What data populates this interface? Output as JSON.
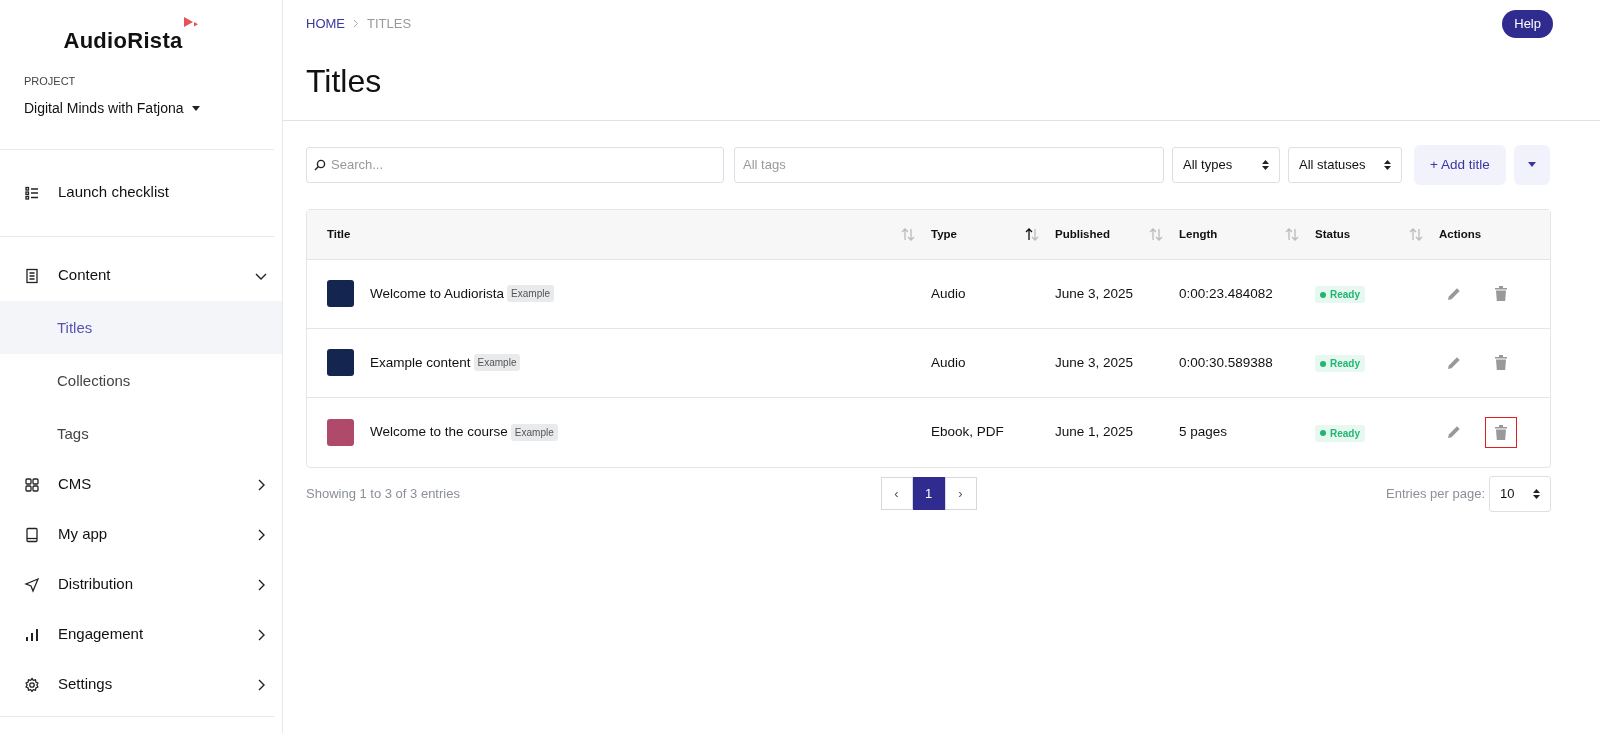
{
  "sidebar": {
    "logo": "AudioRista",
    "project_label": "PROJECT",
    "project_name": "Digital Minds with Fatjona",
    "sections": [
      [
        {
          "label": "Launch checklist",
          "kind": "item"
        }
      ],
      [
        {
          "label": "Content",
          "kind": "group",
          "expanded": true,
          "children": [
            {
              "label": "Titles",
              "selected": true
            },
            {
              "label": "Collections",
              "selected": false
            },
            {
              "label": "Tags",
              "selected": false
            }
          ]
        },
        {
          "label": "CMS",
          "kind": "group",
          "expanded": false
        },
        {
          "label": "My app",
          "kind": "group",
          "expanded": false
        },
        {
          "label": "Distribution",
          "kind": "group",
          "expanded": false
        },
        {
          "label": "Engagement",
          "kind": "group",
          "expanded": false
        },
        {
          "label": "Settings",
          "kind": "group",
          "expanded": false
        }
      ]
    ]
  },
  "breadcrumb": [
    "HOME",
    "TITLES"
  ],
  "help_button": "Help",
  "page_title": "Titles",
  "filters": {
    "search_placeholder": "Search...",
    "tags_placeholder": "All tags",
    "type_select": "All types",
    "status_select": "All statuses",
    "add_button": "+ Add title"
  },
  "table": {
    "columns": [
      {
        "label": "Title",
        "kind": "sortable",
        "sorted": false
      },
      {
        "label": "Type",
        "kind": "sortable",
        "sorted": true
      },
      {
        "label": "Published",
        "kind": "sortable",
        "sorted": false
      },
      {
        "label": "Length",
        "kind": "sortable",
        "sorted": false
      },
      {
        "label": "Status",
        "kind": "sortable",
        "sorted": false
      },
      {
        "label": "Actions",
        "kind": "plain"
      }
    ],
    "rows": [
      {
        "title": "Welcome to Audiorista",
        "tag": "Example",
        "type": "Audio",
        "published": "June 3, 2025",
        "length": "0:00:23.484082",
        "status": "Ready",
        "delete_highlighted": false
      },
      {
        "title": "Example content",
        "tag": "Example",
        "type": "Audio",
        "published": "June 3, 2025",
        "length": "0:00:30.589388",
        "status": "Ready",
        "delete_highlighted": false
      },
      {
        "title": "Welcome to the course",
        "tag": "Example",
        "type": "Ebook, PDF",
        "published": "June 1, 2025",
        "length": "5 pages",
        "status": "Ready",
        "delete_highlighted": true
      }
    ]
  },
  "footer": {
    "showing": "Showing 1 to 3 of 3 entries",
    "pages": [
      {
        "label": "1",
        "selected": true
      }
    ],
    "prev": "‹",
    "next": "›",
    "per_page_label": "Entries per page:",
    "per_page": "10"
  }
}
